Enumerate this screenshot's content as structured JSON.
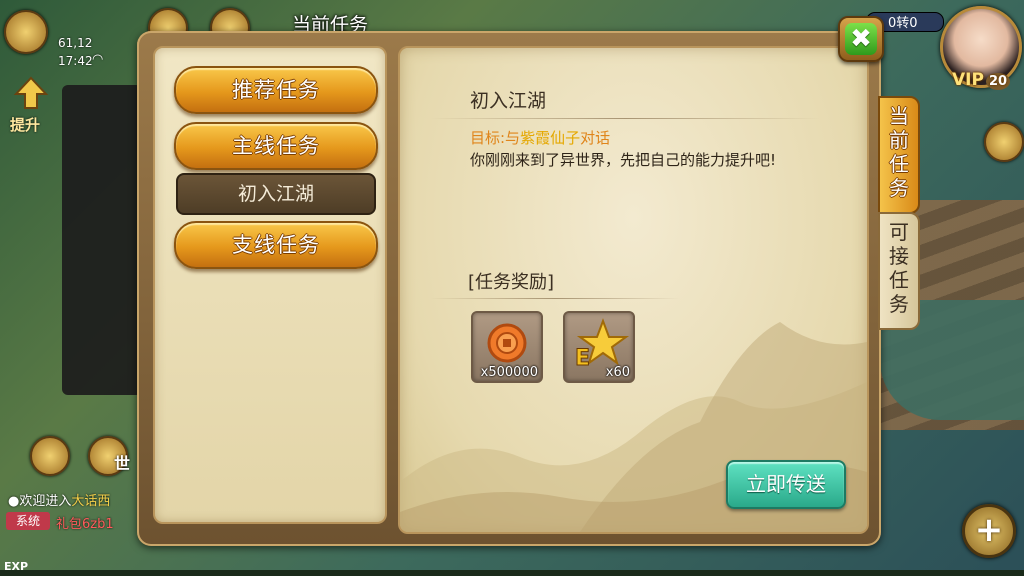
{
  "hud": {
    "coords": "61,12",
    "time": "17:42",
    "upgrade_label": "提升",
    "top_title": "当前任务",
    "currency_text": "0转0",
    "vip_label": "VIP",
    "vip_level": "20",
    "world_label": "世"
  },
  "categories": [
    {
      "label": "推荐任务"
    },
    {
      "label": "主线任务"
    },
    {
      "label": "支线任务"
    }
  ],
  "selected_quest": "初入江湖",
  "quest": {
    "title": "初入江湖",
    "goal_prefix": "目标:与",
    "goal_npc": "紫霞仙子",
    "goal_suffix": "对话",
    "description": "你刚刚来到了异世界，先把自己的能力提升吧!",
    "reward_title": "[任务奖励]",
    "rewards": [
      {
        "icon": "coin-icon",
        "quantity": "x500000"
      },
      {
        "icon": "exp-star-icon",
        "quantity": "x60"
      }
    ],
    "teleport_label": "立即传送"
  },
  "side_tabs": [
    {
      "chars": [
        "当",
        "前",
        "任",
        "务"
      ],
      "active": true
    },
    {
      "chars": [
        "可",
        "接",
        "任",
        "务"
      ],
      "active": false
    }
  ],
  "close_label": "✖",
  "chat": {
    "welcome_prefix": "●欢迎进入",
    "welcome_highlight": "大话西",
    "system_badge": "系统",
    "system_message": "礼包6zb1"
  },
  "exp_label": "EXP",
  "plus_label": "+",
  "colors": {
    "category_gold": "#e5981c",
    "teleport_teal": "#2aa98a",
    "goal_orange": "#e0851a",
    "close_green": "#2f9a1c"
  }
}
